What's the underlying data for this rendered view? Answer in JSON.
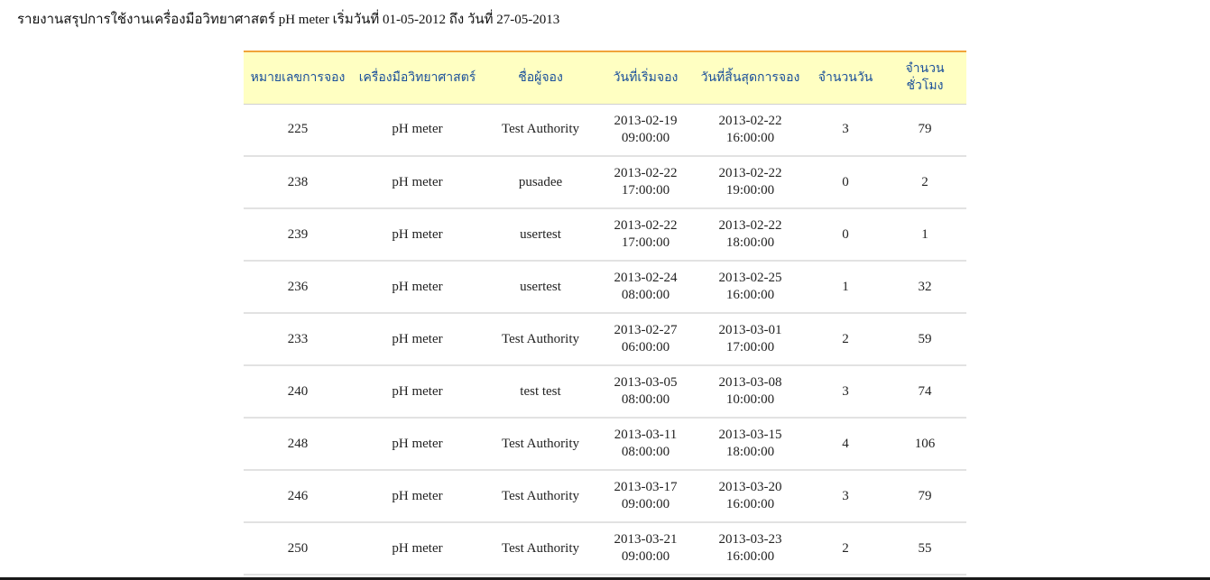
{
  "report": {
    "title": "รายงานสรุปการใช้งานเครื่องมือวิทยาศาสตร์ pH meter เริ่มวันที่ 01-05-2012 ถึง วันที่ 27-05-2013"
  },
  "table": {
    "headers": [
      {
        "line1": "หมายเลขการ",
        "line2": "จอง"
      },
      {
        "line1": "เครื่องมือ",
        "line2": "วิทยาศาสตร์"
      },
      {
        "line1": "ชื่อผู้จอง",
        "line2": ""
      },
      {
        "line1": "วันที่เริ่มจอง",
        "line2": ""
      },
      {
        "line1": "วันที่สิ้นสุดการ",
        "line2": "จอง"
      },
      {
        "line1": "จำนวนวัน",
        "line2": ""
      },
      {
        "line1": "จำนวน",
        "line2": "ชั่วโมง"
      }
    ],
    "rows": [
      {
        "id": "225",
        "instrument": "pH meter",
        "booker": "Test Authority",
        "start_date": "2013-02-19",
        "start_time": "09:00:00",
        "end_date": "2013-02-22",
        "end_time": "16:00:00",
        "days": "3",
        "hours": "79"
      },
      {
        "id": "238",
        "instrument": "pH meter",
        "booker": "pusadee",
        "start_date": "2013-02-22",
        "start_time": "17:00:00",
        "end_date": "2013-02-22",
        "end_time": "19:00:00",
        "days": "0",
        "hours": "2"
      },
      {
        "id": "239",
        "instrument": "pH meter",
        "booker": "usertest",
        "start_date": "2013-02-22",
        "start_time": "17:00:00",
        "end_date": "2013-02-22",
        "end_time": "18:00:00",
        "days": "0",
        "hours": "1"
      },
      {
        "id": "236",
        "instrument": "pH meter",
        "booker": "usertest",
        "start_date": "2013-02-24",
        "start_time": "08:00:00",
        "end_date": "2013-02-25",
        "end_time": "16:00:00",
        "days": "1",
        "hours": "32"
      },
      {
        "id": "233",
        "instrument": "pH meter",
        "booker": "Test Authority",
        "start_date": "2013-02-27",
        "start_time": "06:00:00",
        "end_date": "2013-03-01",
        "end_time": "17:00:00",
        "days": "2",
        "hours": "59"
      },
      {
        "id": "240",
        "instrument": "pH meter",
        "booker": "test test",
        "start_date": "2013-03-05",
        "start_time": "08:00:00",
        "end_date": "2013-03-08",
        "end_time": "10:00:00",
        "days": "3",
        "hours": "74"
      },
      {
        "id": "248",
        "instrument": "pH meter",
        "booker": "Test Authority",
        "start_date": "2013-03-11",
        "start_time": "08:00:00",
        "end_date": "2013-03-15",
        "end_time": "18:00:00",
        "days": "4",
        "hours": "106"
      },
      {
        "id": "246",
        "instrument": "pH meter",
        "booker": "Test Authority",
        "start_date": "2013-03-17",
        "start_time": "09:00:00",
        "end_date": "2013-03-20",
        "end_time": "16:00:00",
        "days": "3",
        "hours": "79"
      },
      {
        "id": "250",
        "instrument": "pH meter",
        "booker": "Test Authority",
        "start_date": "2013-03-21",
        "start_time": "09:00:00",
        "end_date": "2013-03-23",
        "end_time": "16:00:00",
        "days": "2",
        "hours": "55"
      }
    ]
  },
  "colors": {
    "header_background": "#ffffc2",
    "header_text": "#1a4f9a",
    "header_top_border": "#f0a43a",
    "row_divider": "#e2e2e2"
  }
}
